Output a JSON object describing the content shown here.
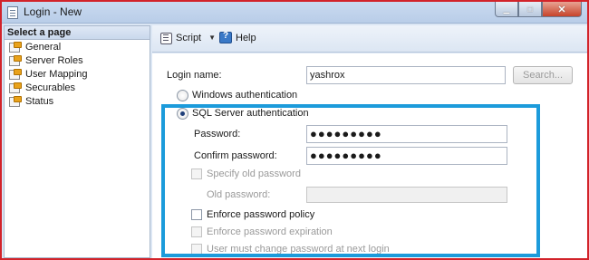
{
  "window": {
    "title": "Login - New"
  },
  "left_panel": {
    "header": "Select a page",
    "items": [
      {
        "label": "General",
        "icon": "page-icon"
      },
      {
        "label": "Server Roles",
        "icon": "page-icon"
      },
      {
        "label": "User Mapping",
        "icon": "page-icon"
      },
      {
        "label": "Securables",
        "icon": "page-icon"
      },
      {
        "label": "Status",
        "icon": "page-icon"
      }
    ]
  },
  "toolbar": {
    "script_label": "Script",
    "help_label": "Help"
  },
  "form": {
    "login_name_label": "Login name:",
    "login_name_value": "yashrox",
    "search_label": "Search...",
    "windows_auth_label": "Windows authentication",
    "sql_auth_label": "SQL Server authentication",
    "password_label": "Password:",
    "password_value": "●●●●●●●●●",
    "confirm_password_label": "Confirm password:",
    "confirm_password_value": "●●●●●●●●●",
    "specify_old_password_label": "Specify old password",
    "old_password_label": "Old password:",
    "enforce_policy_label": "Enforce password policy",
    "enforce_expiration_label": "Enforce password expiration",
    "must_change_label": "User must change password at next login"
  },
  "colors": {
    "highlight": "#1c9bdb",
    "window_border": "#d2232a",
    "title_bar": "#c9daf0"
  }
}
